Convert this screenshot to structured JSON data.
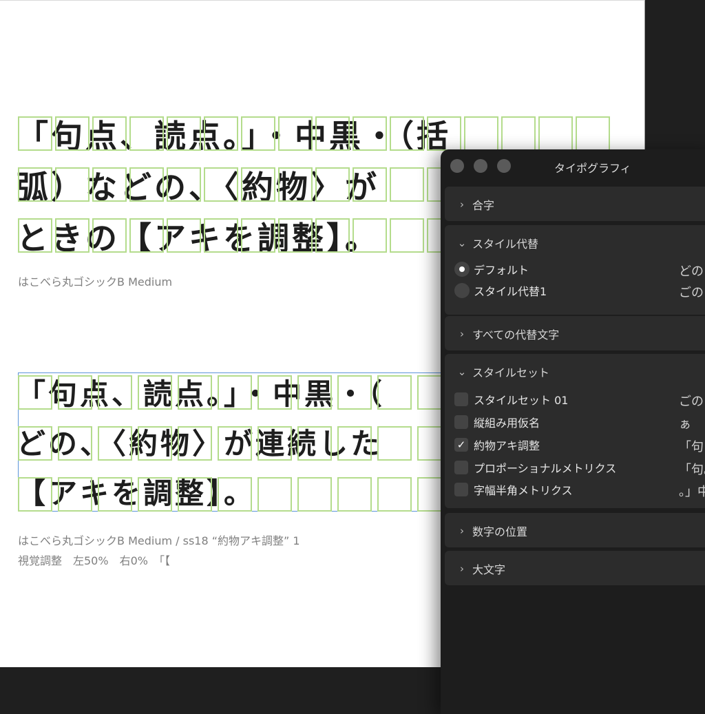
{
  "document": {
    "sample1_lines": [
      "「句点、読点。」・中黒・（括",
      "弧）などの、〈約物〉が",
      "ときの【アキを調整】。"
    ],
    "sample1_caption": "はこべら丸ゴシックB Medium",
    "sample2_lines": [
      "「句点、読点。」・中黒・（",
      "どの、〈約物〉が連続した",
      "【アキを調整】。"
    ],
    "sample2_caption_line1": "はこべら丸ゴシックB Medium / ss18 “約物アキ調整” 1",
    "sample2_caption_line2": "視覚調整　左50%　右0%　「【"
  },
  "panel": {
    "title": "タイポグラフィ",
    "sections": {
      "ligatures": {
        "label": "合字",
        "expanded": false
      },
      "stylistic_alternates": {
        "label": "スタイル代替",
        "expanded": true,
        "options": [
          {
            "label": "デフォルト",
            "selected": true,
            "preview": "どの"
          },
          {
            "label": "スタイル代替1",
            "selected": false,
            "preview": "ごの"
          }
        ]
      },
      "all_alternates": {
        "label": "すべての代替文字",
        "expanded": false
      },
      "style_sets": {
        "label": "スタイルセット",
        "expanded": true,
        "items": [
          {
            "label": "スタイルセット 01",
            "checked": false,
            "preview": "ごの"
          },
          {
            "label": "縦組み用仮名",
            "checked": false,
            "preview": "ぁ"
          },
          {
            "label": "約物アキ調整",
            "checked": true,
            "preview": "「句"
          },
          {
            "label": "プロポーショナルメトリクス",
            "checked": false,
            "preview": "「句。"
          },
          {
            "label": "字幅半角メトリクス",
            "checked": false,
            "preview": "。」中"
          }
        ]
      },
      "number_position": {
        "label": "数字の位置",
        "expanded": false
      },
      "capitals": {
        "label": "大文字",
        "expanded": false
      }
    },
    "check_glyph": "✓"
  },
  "icons": {
    "collapsed": "chevron-right-icon",
    "expanded": "chevron-down-icon"
  }
}
